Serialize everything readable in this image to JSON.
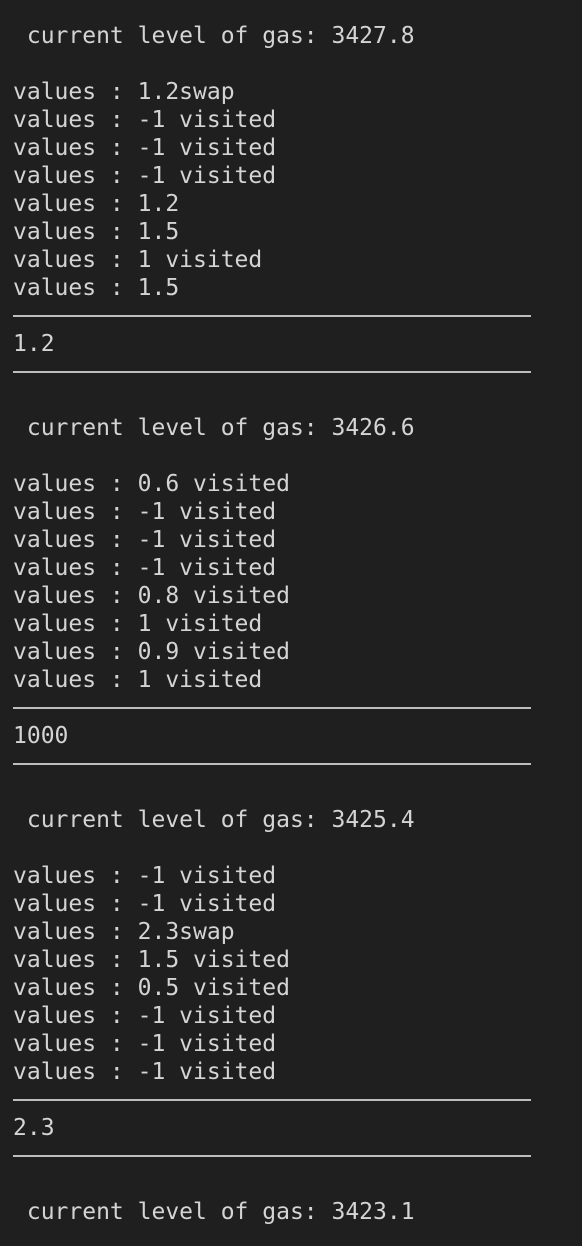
{
  "terminal": {
    "blocks": [
      {
        "gas_line": " current level of gas: 3427.8",
        "values": [
          "values : 1.2swap",
          "values : -1 visited",
          "values : -1 visited",
          "values : -1 visited",
          "values : 1.2",
          "values : 1.5",
          "values : 1 visited",
          "values : 1.5"
        ],
        "result": "1.2"
      },
      {
        "gas_line": " current level of gas: 3426.6",
        "values": [
          "values : 0.6 visited",
          "values : -1 visited",
          "values : -1 visited",
          "values : -1 visited",
          "values : 0.8 visited",
          "values : 1 visited",
          "values : 0.9 visited",
          "values : 1 visited"
        ],
        "result": "1000"
      },
      {
        "gas_line": " current level of gas: 3425.4",
        "values": [
          "values : -1 visited",
          "values : -1 visited",
          "values : 2.3swap",
          "values : 1.5 visited",
          "values : 0.5 visited",
          "values : -1 visited",
          "values : -1 visited",
          "values : -1 visited"
        ],
        "result": "2.3"
      }
    ],
    "final_gas_line": " current level of gas: 3423.1"
  }
}
